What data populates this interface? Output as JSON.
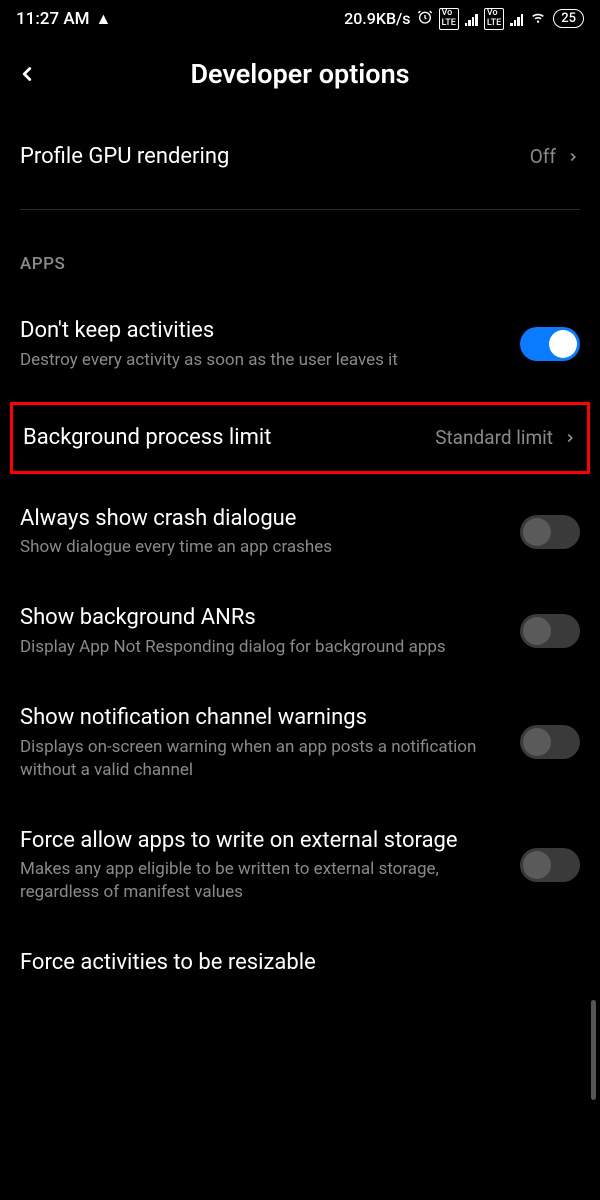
{
  "status_bar": {
    "time": "11:27 AM",
    "data_rate": "20.9KB/s",
    "battery": "25"
  },
  "header": {
    "title": "Developer options"
  },
  "settings": {
    "profile_gpu": {
      "title": "Profile GPU rendering",
      "value": "Off"
    },
    "section_apps": "APPS",
    "dont_keep": {
      "title": "Don't keep activities",
      "subtitle": "Destroy every activity as soon as the user leaves it"
    },
    "bg_process": {
      "title": "Background process limit",
      "value": "Standard limit"
    },
    "crash_dialog": {
      "title": "Always show crash dialogue",
      "subtitle": "Show dialogue every time an app crashes"
    },
    "bg_anrs": {
      "title": "Show background ANRs",
      "subtitle": "Display App Not Responding dialog for background apps"
    },
    "notif_channel": {
      "title": "Show notification channel warnings",
      "subtitle": "Displays on-screen warning when an app posts a notification without a valid channel"
    },
    "force_external": {
      "title": "Force allow apps to write on external storage",
      "subtitle": "Makes any app eligible to be written to external storage, regardless of manifest values"
    },
    "force_resizable": {
      "title": "Force activities to be resizable"
    }
  }
}
